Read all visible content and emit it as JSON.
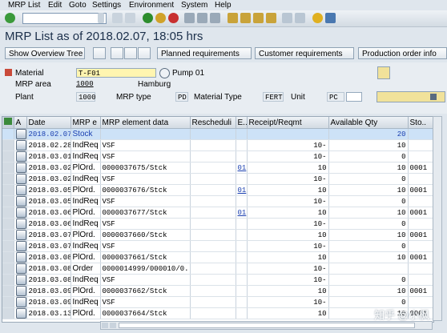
{
  "menu": [
    "MRP List",
    "Edit",
    "Goto",
    "Settings",
    "Environment",
    "System",
    "Help"
  ],
  "title": "MRP List as of 2018.02.07, 18:05 hrs",
  "app_toolbar": {
    "show_overview_tree": "Show Overview Tree",
    "planned_requirements": "Planned requirements",
    "customer_requirements": "Customer requirements",
    "production_order": "Production order info"
  },
  "header": {
    "material_label": "Material",
    "material_value": "T-F01",
    "material_desc": "Pump 01",
    "mrp_area_label": "MRP area",
    "mrp_area_value": "1000",
    "mrp_area_desc": "Hamburg",
    "plant_label": "Plant",
    "plant_value": "1000",
    "mrp_type_label": "MRP type",
    "mrp_type_value": "PD",
    "material_type_label": "Material Type",
    "material_type_value": "FERT",
    "unit_label": "Unit",
    "unit_value": "PC"
  },
  "grid": {
    "columns": [
      "A",
      "Date",
      "MRP e",
      "MRP element data",
      "Rescheduli",
      "E..",
      "Receipt/Reqmt",
      "Available Qty",
      "Sto.."
    ],
    "rows": [
      {
        "date": "2018.02.07",
        "elem": "Stock",
        "data": "",
        "resched": "",
        "e": "",
        "receipt": "",
        "avail": "20",
        "sto": "",
        "selected": true
      },
      {
        "date": "2018.02.28",
        "elem": "IndReq",
        "data": "VSF",
        "resched": "",
        "e": "",
        "receipt": "10-",
        "avail": "10",
        "sto": ""
      },
      {
        "date": "2018.03.01",
        "elem": "IndReq",
        "data": "VSF",
        "resched": "",
        "e": "",
        "receipt": "10-",
        "avail": "0",
        "sto": ""
      },
      {
        "date": "2018.03.02",
        "elem": "PlOrd.",
        "data": "0000037675/Stck",
        "resched": "",
        "e": "01",
        "receipt": "10",
        "avail": "10",
        "sto": "0001"
      },
      {
        "date": "2018.03.02",
        "elem": "IndReq",
        "data": "VSF",
        "resched": "",
        "e": "",
        "receipt": "10-",
        "avail": "0",
        "sto": ""
      },
      {
        "date": "2018.03.05",
        "elem": "PlOrd.",
        "data": "0000037676/Stck",
        "resched": "",
        "e": "01",
        "receipt": "10",
        "avail": "10",
        "sto": "0001"
      },
      {
        "date": "2018.03.05",
        "elem": "IndReq",
        "data": "VSF",
        "resched": "",
        "e": "",
        "receipt": "10-",
        "avail": "0",
        "sto": ""
      },
      {
        "date": "2018.03.06",
        "elem": "PlOrd.",
        "data": "0000037677/Stck",
        "resched": "",
        "e": "01",
        "receipt": "10",
        "avail": "10",
        "sto": "0001"
      },
      {
        "date": "2018.03.06",
        "elem": "IndReq",
        "data": "VSF",
        "resched": "",
        "e": "",
        "receipt": "10-",
        "avail": "0",
        "sto": ""
      },
      {
        "date": "2018.03.07",
        "elem": "PlOrd.",
        "data": "0000037660/Stck",
        "resched": "",
        "e": "",
        "receipt": "10",
        "avail": "10",
        "sto": "0001"
      },
      {
        "date": "2018.03.07",
        "elem": "IndReq",
        "data": "VSF",
        "resched": "",
        "e": "",
        "receipt": "10-",
        "avail": "0",
        "sto": ""
      },
      {
        "date": "2018.03.08",
        "elem": "PlOrd.",
        "data": "0000037661/Stck",
        "resched": "",
        "e": "",
        "receipt": "10",
        "avail": "10",
        "sto": "0001"
      },
      {
        "date": "2018.03.08",
        "elem": "Order",
        "data": "0000014999/000010/0...",
        "resched": "",
        "e": "",
        "receipt": "10-",
        "avail": "",
        "sto": ""
      },
      {
        "date": "2018.03.08",
        "elem": "IndReq",
        "data": "VSF",
        "resched": "",
        "e": "",
        "receipt": "10-",
        "avail": "0",
        "sto": ""
      },
      {
        "date": "2018.03.09",
        "elem": "PlOrd.",
        "data": "0000037662/Stck",
        "resched": "",
        "e": "",
        "receipt": "10",
        "avail": "10",
        "sto": "0001"
      },
      {
        "date": "2018.03.09",
        "elem": "IndReq",
        "data": "VSF",
        "resched": "",
        "e": "",
        "receipt": "10-",
        "avail": "0",
        "sto": ""
      },
      {
        "date": "2018.03.13",
        "elem": "PlOrd.",
        "data": "0000037664/Stck",
        "resched": "",
        "e": "",
        "receipt": "10",
        "avail": "10",
        "sto": "0001"
      }
    ]
  },
  "watermark": "知乎 @小枫"
}
